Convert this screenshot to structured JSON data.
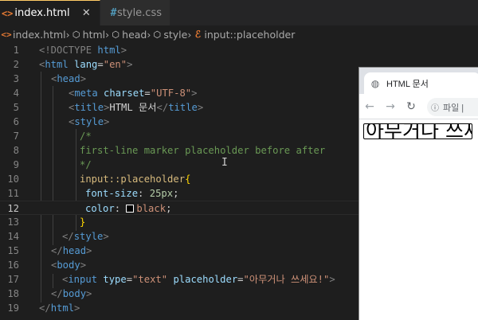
{
  "tabs": [
    {
      "label": "index.html",
      "icon": "html-file-icon",
      "active": true,
      "close": "✕"
    },
    {
      "label": "style.css",
      "icon": "css-file-icon",
      "active": false
    }
  ],
  "breadcrumb": [
    "index.html",
    "html",
    "head",
    "style",
    "input::placeholder"
  ],
  "editor": {
    "current_line": 12,
    "lines": [
      {
        "n": "1"
      },
      {
        "n": "2"
      },
      {
        "n": "3"
      },
      {
        "n": "4"
      },
      {
        "n": "5"
      },
      {
        "n": "6"
      },
      {
        "n": "7"
      },
      {
        "n": "8"
      },
      {
        "n": "9"
      },
      {
        "n": "10"
      },
      {
        "n": "11"
      },
      {
        "n": "12"
      },
      {
        "n": "13"
      },
      {
        "n": "14"
      },
      {
        "n": "15"
      },
      {
        "n": "16"
      },
      {
        "n": "17"
      },
      {
        "n": "18"
      },
      {
        "n": "19"
      }
    ],
    "tokens": {
      "doctype_open": "<!DOCTYPE",
      "doctype_html": "html",
      "doctype_close": ">",
      "lt": "<",
      "gt": ">",
      "lt_slash": "</",
      "eq": "=",
      "html": "html",
      "lang": "lang",
      "lang_val": "\"en\"",
      "head": "head",
      "meta": "meta",
      "charset": "charset",
      "charset_val": "\"UTF-8\"",
      "title": "title",
      "title_text": "HTML 문서",
      "style": "style",
      "comment_open": "/*",
      "comment_text": "first-line marker placeholder before after",
      "comment_close": "*/",
      "selector": "input::placeholder",
      "brace_open": "{",
      "brace_close": "}",
      "prop_font_size": "font-size",
      "colon": ":",
      "font_size_val": "25px",
      "semicolon": ";",
      "prop_color": "color",
      "color_val": "black",
      "body": "body",
      "input": "input",
      "type": "type",
      "type_val": "\"text\"",
      "placeholder": "placeholder",
      "placeholder_val": "\"아무거나 쓰세요!\""
    }
  },
  "browser": {
    "tab_title": "HTML 문서",
    "address_text": "파일 |",
    "input_placeholder": "아무거나 쓰세요!",
    "nav_back": "←",
    "nav_forward": "→",
    "nav_reload": "↻"
  },
  "colors": {
    "editor_bg": "#1e1e1e",
    "tag": "#569cd6",
    "attr": "#9cdcfe",
    "string": "#ce9178",
    "comment": "#6a9955",
    "selector": "#d7ba7d",
    "brace": "#ffd700",
    "active_tab_accent": "#ffcc66"
  }
}
